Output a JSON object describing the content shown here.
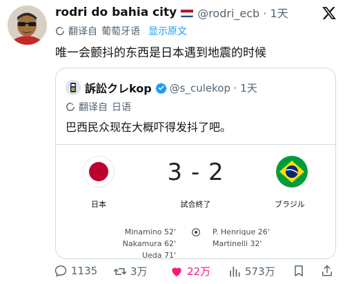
{
  "tweet": {
    "author_name": "rodri do bahia city",
    "flag_icon": "netherlands-flag-icon",
    "handle_time": "@rodri_ecb · 1天",
    "translate_label": "翻译自",
    "translate_lang": "葡萄牙语",
    "show_original": "显示原文",
    "text": "唯一会颤抖的东西是日本遇到地震的时候"
  },
  "quote": {
    "author_name": "訴訟クレkop",
    "handle_time": "@s_culekop · 1天",
    "translate_label": "翻译自",
    "translate_lang": "日语",
    "text": "巴西民众现在大概吓得发抖了吧。",
    "match": {
      "home_team": "日本",
      "away_team": "ブラジル",
      "score": "3 - 2",
      "status": "試合終了",
      "home_scorers": [
        "Minamino 52'",
        "Nakamura 62'",
        "Ueda 71'"
      ],
      "away_scorers": [
        "P. Henrique 26'",
        "Martinelli 32'"
      ]
    }
  },
  "actions": {
    "replies": "1135",
    "retweets": "3万",
    "likes": "22万",
    "views": "573万"
  },
  "colors": {
    "link": "#1d9bf0",
    "like": "#f91880",
    "muted": "#536471",
    "japan_red": "#bc002d",
    "brazil_green": "#009c3b",
    "brazil_yellow": "#ffdf00"
  }
}
